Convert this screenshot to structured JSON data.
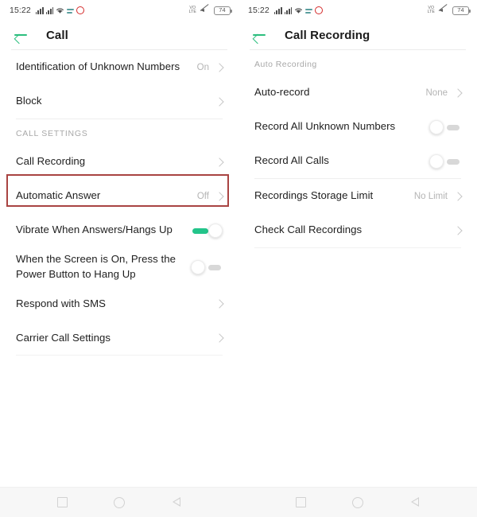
{
  "colors": {
    "accent_green": "#2cbe7e",
    "toggle_on": "#23c48a",
    "highlight_border": "#a94442",
    "battery_text": "#5a5a5a",
    "value_text": "#b4b4b4",
    "label_text": "#212121"
  },
  "status_bar": {
    "time": "15:22",
    "icons_left": [
      "signal-bars-sim1",
      "signal-bars-sim2",
      "wifi-icon",
      "sync-icon",
      "opera-icon"
    ],
    "volte_label": "VoLTE",
    "icons_right": [
      "volte-icon",
      "mute-icon"
    ],
    "battery_level": "74"
  },
  "left_panel": {
    "appbar": {
      "back_icon": "back-arrow-icon",
      "title": "Call"
    },
    "items": [
      {
        "label": "Identification of Unknown Numbers",
        "value": "On",
        "type": "link"
      },
      {
        "label": "Block",
        "value": "",
        "type": "link"
      }
    ],
    "section_header": "CALL SETTINGS",
    "settings_items": [
      {
        "label": "Call Recording",
        "value": "",
        "type": "link",
        "highlighted": true
      },
      {
        "label": "Automatic Answer",
        "value": "Off",
        "type": "link"
      },
      {
        "label": "Vibrate When Answers/Hangs Up",
        "value": "",
        "type": "toggle",
        "toggle_state": "on"
      },
      {
        "label": "When the Screen is On, Press the Power Button to Hang Up",
        "value": "",
        "type": "toggle",
        "toggle_state": "off"
      },
      {
        "label": "Respond with SMS",
        "value": "",
        "type": "link"
      },
      {
        "label": "Carrier Call Settings",
        "value": "",
        "type": "link"
      }
    ]
  },
  "right_panel": {
    "appbar": {
      "back_icon": "back-arrow-icon",
      "title": "Call Recording"
    },
    "section_header": "Auto Recording",
    "items": [
      {
        "label": "Auto-record",
        "value": "None",
        "type": "link"
      },
      {
        "label": "Record All Unknown Numbers",
        "value": "",
        "type": "toggle",
        "toggle_state": "off"
      },
      {
        "label": "Record All Calls",
        "value": "",
        "type": "toggle",
        "toggle_state": "off"
      }
    ],
    "items_group2": [
      {
        "label": "Recordings Storage Limit",
        "value": "No Limit",
        "type": "link"
      },
      {
        "label": "Check Call Recordings",
        "value": "",
        "type": "link"
      }
    ]
  },
  "nav_bar": {
    "buttons": [
      "recents-square-icon",
      "home-circle-icon",
      "back-triangle-icon"
    ]
  }
}
